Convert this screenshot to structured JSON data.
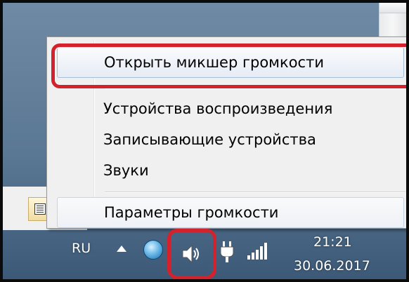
{
  "menu": {
    "items": [
      {
        "label": "Открыть микшер громкости"
      },
      {
        "label": "Устройства воспроизведения"
      },
      {
        "label": "Записывающие устройства"
      },
      {
        "label": "Звуки"
      },
      {
        "label": "Параметры громкости"
      }
    ]
  },
  "tray": {
    "language": "RU",
    "time": "21:21",
    "date": "30.06.2017",
    "icons": [
      "show-hidden-icons-arrow",
      "network-globe-icon",
      "speaker-icon",
      "power-plug-icon",
      "signal-bars-icon"
    ]
  },
  "colors": {
    "highlight": "#d3222c",
    "menu_background": "#f0f0f0",
    "taskbar": "#5a7793"
  }
}
